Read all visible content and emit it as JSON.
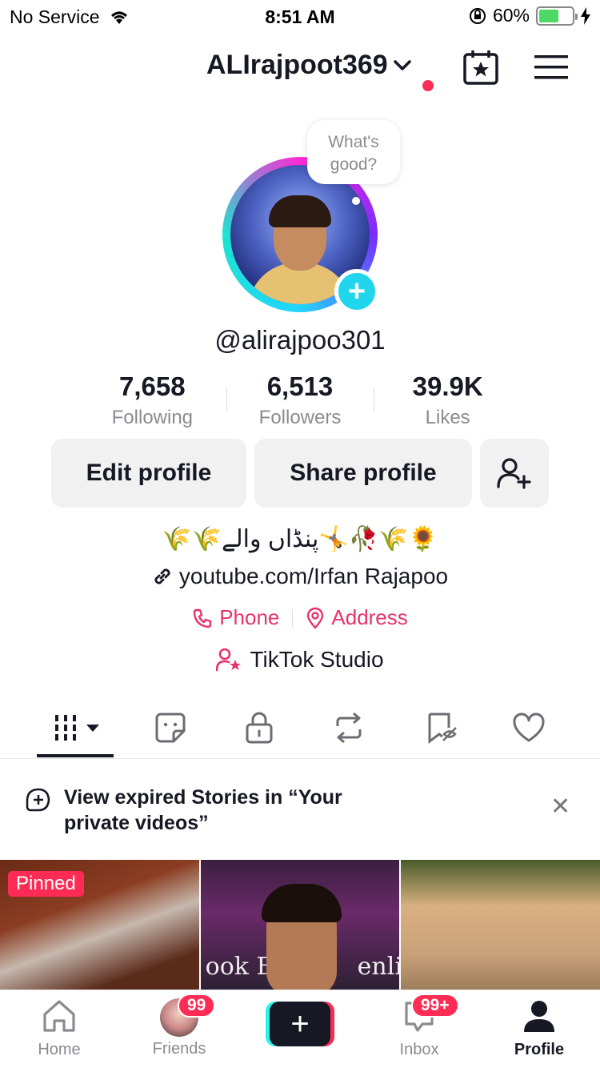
{
  "status_bar": {
    "carrier": "No Service",
    "time": "8:51 AM",
    "battery_percent": "60%",
    "battery_level": 0.6
  },
  "header": {
    "username": "ALIrajpoot369"
  },
  "avatar": {
    "bubble_text": "What's good?"
  },
  "profile": {
    "handle": "@alirajpoo301"
  },
  "stats": [
    {
      "value": "7,658",
      "label": "Following"
    },
    {
      "value": "6,513",
      "label": "Followers"
    },
    {
      "value": "39.9K",
      "label": "Likes"
    }
  ],
  "buttons": {
    "edit": "Edit profile",
    "share": "Share profile"
  },
  "bio": {
    "text": "🌾🌾پنڈاں والے🤸🥀🌾🌻",
    "link": "youtube.com/Irfan Rajapoo",
    "phone": "Phone",
    "address": "Address",
    "studio": "TikTok Studio"
  },
  "banner": {
    "text": "View expired Stories in “Your private videos”"
  },
  "grid": {
    "pinned_label": "Pinned",
    "video2_left_text": "ook B",
    "video2_right_text": "enlic"
  },
  "nav": {
    "home": "Home",
    "friends": "Friends",
    "friends_badge": "99",
    "inbox": "Inbox",
    "inbox_badge": "99+",
    "profile": "Profile"
  },
  "colors": {
    "accent_red": "#fe2c55",
    "contact_pink": "#e8336a",
    "avatar_plus": "#20d5ec"
  }
}
